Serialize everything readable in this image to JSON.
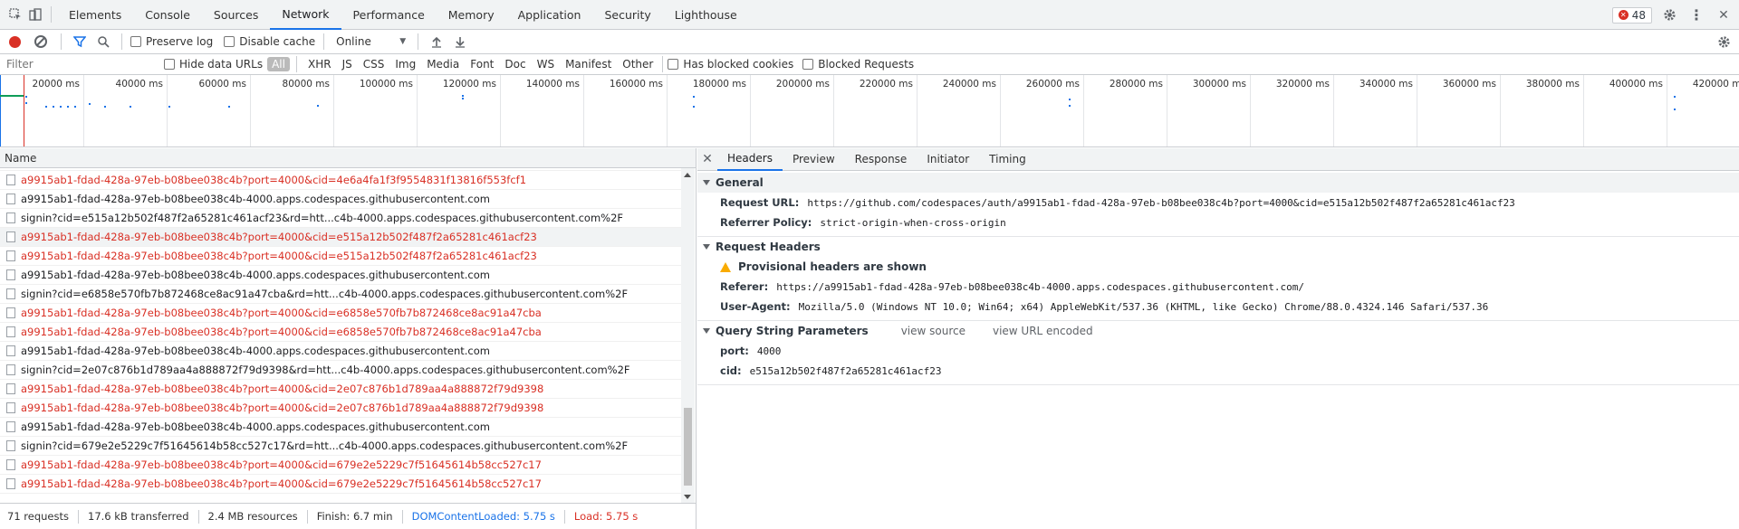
{
  "tabs": [
    "Elements",
    "Console",
    "Sources",
    "Network",
    "Performance",
    "Memory",
    "Application",
    "Security",
    "Lighthouse"
  ],
  "active_tab": "Network",
  "error_count": "48",
  "toolbar": {
    "preserve_log": "Preserve log",
    "disable_cache": "Disable cache",
    "throttling": "Online"
  },
  "filter_bar": {
    "placeholder": "Filter",
    "hide_data_urls": "Hide data URLs",
    "types": [
      "All",
      "XHR",
      "JS",
      "CSS",
      "Img",
      "Media",
      "Font",
      "Doc",
      "WS",
      "Manifest",
      "Other"
    ],
    "has_blocked_cookies": "Has blocked cookies",
    "blocked_requests": "Blocked Requests"
  },
  "overview_labels": [
    "20000 ms",
    "40000 ms",
    "60000 ms",
    "80000 ms",
    "100000 ms",
    "120000 ms",
    "140000 ms",
    "160000 ms",
    "180000 ms",
    "200000 ms",
    "220000 ms",
    "240000 ms",
    "260000 ms",
    "280000 ms",
    "300000 ms",
    "320000 ms",
    "340000 ms",
    "360000 ms",
    "380000 ms",
    "400000 ms",
    "420000 ms"
  ],
  "name_header": "Name",
  "requests": [
    {
      "name": "a9915ab1-fdad-428a-97eb-b08bee038c4b?port=4000&cid=4e6a4fa1f3f9554831f13816f553fcf1",
      "error": true
    },
    {
      "name": "a9915ab1-fdad-428a-97eb-b08bee038c4b-4000.apps.codespaces.githubusercontent.com",
      "error": false
    },
    {
      "name": "signin?cid=e515a12b502f487f2a65281c461acf23&rd=htt...c4b-4000.apps.codespaces.githubusercontent.com%2F",
      "error": false
    },
    {
      "name": "a9915ab1-fdad-428a-97eb-b08bee038c4b?port=4000&cid=e515a12b502f487f2a65281c461acf23",
      "error": true,
      "selected": true
    },
    {
      "name": "a9915ab1-fdad-428a-97eb-b08bee038c4b?port=4000&cid=e515a12b502f487f2a65281c461acf23",
      "error": true
    },
    {
      "name": "a9915ab1-fdad-428a-97eb-b08bee038c4b-4000.apps.codespaces.githubusercontent.com",
      "error": false
    },
    {
      "name": "signin?cid=e6858e570fb7b872468ce8ac91a47cba&rd=htt...c4b-4000.apps.codespaces.githubusercontent.com%2F",
      "error": false
    },
    {
      "name": "a9915ab1-fdad-428a-97eb-b08bee038c4b?port=4000&cid=e6858e570fb7b872468ce8ac91a47cba",
      "error": true
    },
    {
      "name": "a9915ab1-fdad-428a-97eb-b08bee038c4b?port=4000&cid=e6858e570fb7b872468ce8ac91a47cba",
      "error": true
    },
    {
      "name": "a9915ab1-fdad-428a-97eb-b08bee038c4b-4000.apps.codespaces.githubusercontent.com",
      "error": false
    },
    {
      "name": "signin?cid=2e07c876b1d789aa4a888872f79d9398&rd=htt...c4b-4000.apps.codespaces.githubusercontent.com%2F",
      "error": false
    },
    {
      "name": "a9915ab1-fdad-428a-97eb-b08bee038c4b?port=4000&cid=2e07c876b1d789aa4a888872f79d9398",
      "error": true
    },
    {
      "name": "a9915ab1-fdad-428a-97eb-b08bee038c4b?port=4000&cid=2e07c876b1d789aa4a888872f79d9398",
      "error": true
    },
    {
      "name": "a9915ab1-fdad-428a-97eb-b08bee038c4b-4000.apps.codespaces.githubusercontent.com",
      "error": false
    },
    {
      "name": "signin?cid=679e2e5229c7f51645614b58cc527c17&rd=htt...c4b-4000.apps.codespaces.githubusercontent.com%2F",
      "error": false
    },
    {
      "name": "a9915ab1-fdad-428a-97eb-b08bee038c4b?port=4000&cid=679e2e5229c7f51645614b58cc527c17",
      "error": true
    },
    {
      "name": "a9915ab1-fdad-428a-97eb-b08bee038c4b?port=4000&cid=679e2e5229c7f51645614b58cc527c17",
      "error": true
    }
  ],
  "status": {
    "requests": "71 requests",
    "transferred": "17.6 kB transferred",
    "resources": "2.4 MB resources",
    "finish": "Finish: 6.7 min",
    "dcl": "DOMContentLoaded: 5.75 s",
    "load": "Load: 5.75 s"
  },
  "detail_tabs": [
    "Headers",
    "Preview",
    "Response",
    "Initiator",
    "Timing"
  ],
  "general": {
    "title": "General",
    "request_url_key": "Request URL:",
    "request_url": "https://github.com/codespaces/auth/a9915ab1-fdad-428a-97eb-b08bee038c4b?port=4000&cid=e515a12b502f487f2a65281c461acf23",
    "referrer_policy_key": "Referrer Policy:",
    "referrer_policy": "strict-origin-when-cross-origin"
  },
  "request_headers": {
    "title": "Request Headers",
    "warning": "Provisional headers are shown",
    "referer_key": "Referer:",
    "referer": "https://a9915ab1-fdad-428a-97eb-b08bee038c4b-4000.apps.codespaces.githubusercontent.com/",
    "ua_key": "User-Agent:",
    "ua": "Mozilla/5.0 (Windows NT 10.0; Win64; x64) AppleWebKit/537.36 (KHTML, like Gecko) Chrome/88.0.4324.146 Safari/537.36"
  },
  "query": {
    "title": "Query String Parameters",
    "view_source": "view source",
    "view_url_encoded": "view URL encoded",
    "port_key": "port:",
    "port": "4000",
    "cid_key": "cid:",
    "cid": "e515a12b502f487f2a65281c461acf23"
  }
}
